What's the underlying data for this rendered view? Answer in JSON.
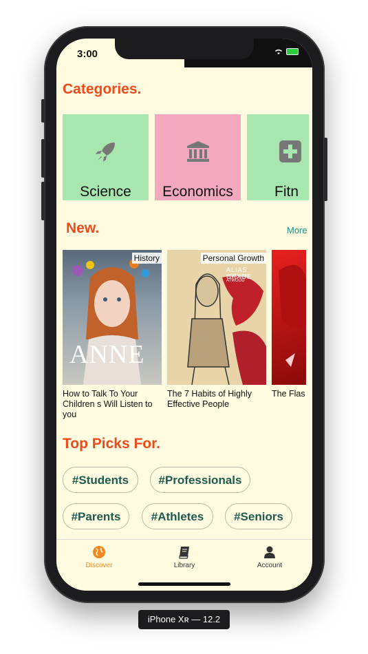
{
  "status_bar": {
    "time": "3:00"
  },
  "categories": {
    "title": "Categories.",
    "items": [
      {
        "label": "Science",
        "icon": "rocket-icon",
        "color": "#a8e6b0"
      },
      {
        "label": "Economics",
        "icon": "bank-icon",
        "color": "#f4a8c0"
      },
      {
        "label": "Fitn",
        "icon": "plus-square-icon",
        "color": "#a8e6b0"
      }
    ]
  },
  "new_section": {
    "title": "New.",
    "more": "More",
    "books": [
      {
        "category": "History",
        "title": "How to Talk To Your Children s Will Listen to you",
        "cover_text": "ANNE"
      },
      {
        "category": "Personal Growth",
        "title": "The 7 Habits of Highly Effective People",
        "cover_text": "ALIAS GRACE",
        "cover_sub": "MARGARET ATWOOD"
      },
      {
        "category": "",
        "title": "The Flas",
        "cover_text": ""
      }
    ]
  },
  "top_picks": {
    "title": "Top Picks For.",
    "tags": [
      "#Students",
      "#Professionals",
      "#Parents",
      "#Athletes",
      "#Seniors"
    ]
  },
  "tab_bar": {
    "tabs": [
      {
        "label": "Discover",
        "icon": "globe-icon",
        "active": true
      },
      {
        "label": "Library",
        "icon": "book-icon",
        "active": false
      },
      {
        "label": "Account",
        "icon": "user-icon",
        "active": false
      }
    ]
  },
  "device_label": "iPhone Xʀ — 12.2",
  "colors": {
    "accent": "#ee4a1a",
    "link": "#1a9080",
    "tag_text": "#1e5a4e",
    "background": "#fffbe0",
    "active_tab": "#f08a20"
  }
}
